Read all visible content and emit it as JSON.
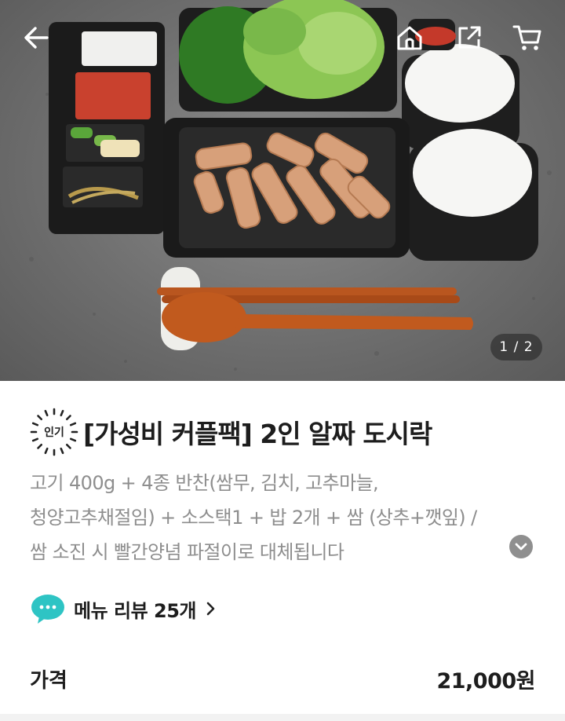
{
  "header": {
    "back_icon": "arrow-left-icon",
    "home_icon": "home-icon",
    "share_icon": "share-icon",
    "cart_icon": "cart-icon"
  },
  "gallery": {
    "pager": "1 / 2",
    "current": 1,
    "total": 2
  },
  "product": {
    "badge": "인기",
    "title": "[가성비 커플팩] 2인 알짜 도시락",
    "description_lines": [
      "고기 400g + 4종 반찬(쌈무, 김치, 고추마늘,",
      "청양고추채절임) + 소스택1 + 밥 2개 + 쌈 (상추+깻잎) /",
      "쌈 소진 시 빨간양념 파절이로 대체됩니다"
    ],
    "expand_icon": "chevron-down-icon"
  },
  "reviews": {
    "label": "메뉴 리뷰 25개",
    "icon": "chat-bubble-icon",
    "accent": "#2ec4c4"
  },
  "price": {
    "label": "가격",
    "value": "21,000원"
  }
}
